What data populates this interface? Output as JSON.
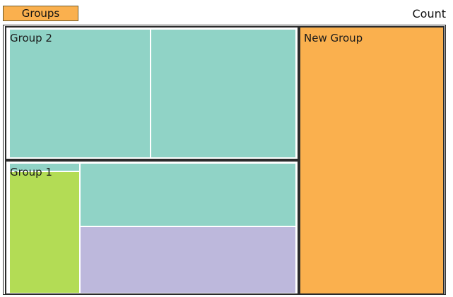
{
  "toolbar": {
    "groups_button": "Groups",
    "count_label": "Count"
  },
  "treemap": {
    "groups": [
      {
        "label": "Group 2",
        "cells": 2,
        "colors": [
          "#90d3c6",
          "#90d3c6"
        ]
      },
      {
        "label": "Group 1",
        "cells": 4,
        "colors": [
          "#b3dc55",
          "#90d3c6",
          "#90d3c6",
          "#bdb8dc"
        ]
      },
      {
        "label": "New Group",
        "cells": 1,
        "colors": [
          "#fab04e"
        ]
      }
    ]
  },
  "colors": {
    "teal": "#90d3c6",
    "green": "#b3dc55",
    "lavender": "#bdb8dc",
    "orange": "#fab04e",
    "border": "#2b2b2b"
  }
}
